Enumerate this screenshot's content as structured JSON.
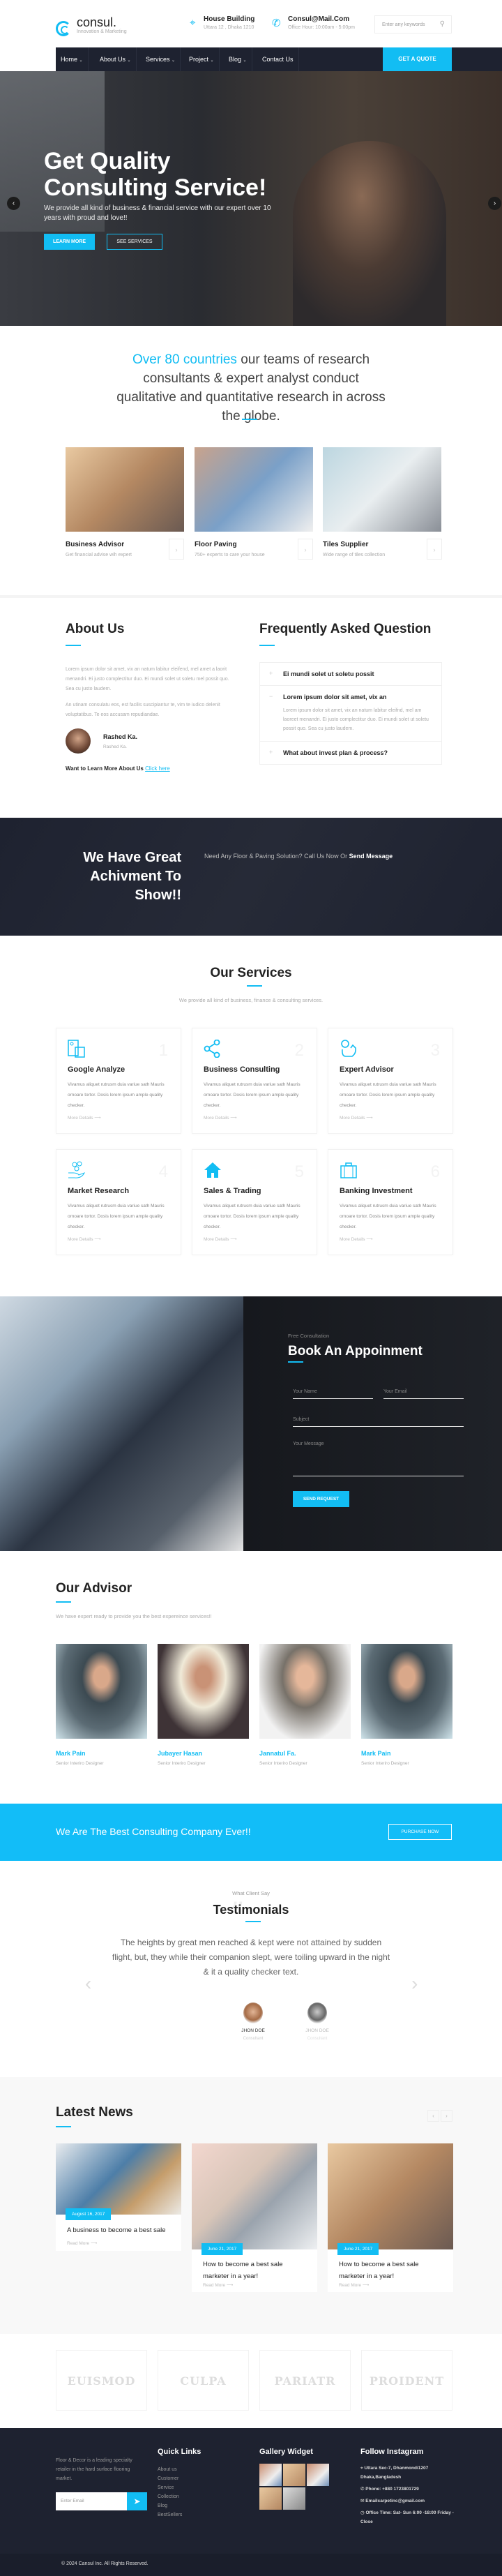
{
  "colors": {
    "accent": "#12bdf3",
    "dark": "#1e2230"
  },
  "header": {
    "logo": {
      "name": "consul.",
      "tagline": "Innovation & Marketing"
    },
    "address": {
      "title": "House Building",
      "sub": "Uttara 12 , Dhaka 1210",
      "icon": "map-pin-icon"
    },
    "contact": {
      "title": "Consul@Mail.Com",
      "sub": "Office Hour: 10:00am - 5:00pm",
      "icon": "phone-icon"
    },
    "search": {
      "placeholder": "Enter any keywords",
      "icon": "search-icon"
    }
  },
  "nav": {
    "items": [
      {
        "label": "Home"
      },
      {
        "label": "About Us"
      },
      {
        "label": "Services"
      },
      {
        "label": "Project"
      },
      {
        "label": "Blog"
      },
      {
        "label": "Contact Us"
      }
    ],
    "cta": "GET A QUOTE"
  },
  "hero": {
    "title": "Get Quality Consulting Service!",
    "desc": "We provide all kind of business & financial service with our expert over 10 years with proud and love!!",
    "learn_more": "LEARN MORE",
    "see_services": "SEE SERVICES"
  },
  "intro": {
    "highlight": "Over 80 countries",
    "text": " our teams of research consultants & expert analyst conduct qualitative and quantitative research in across the globe.",
    "features": [
      {
        "title": "Business Advisor",
        "sub": "Get financial advise wih expert"
      },
      {
        "title": "Floor Paving",
        "sub": "750+ experts to care your house"
      },
      {
        "title": "Tiles Supplier",
        "sub": "Wide range of tiles collection"
      }
    ]
  },
  "about": {
    "title": "About Us",
    "p1": "Lorem ipsum dolor sit amet, vix an natum labitur eleifend, mel amet a laorit menandri. Ei justo complectitur duo. Ei mundi solet ut soletu mel possit quo. Sea cu justo laudem.",
    "p2": "An utinam consulatu eos, est facilis suscipiantur te, vim te iudico delenit voluptatibus. Te eos accusam repudiandae.",
    "person_name": "Rashed Ka.",
    "person_role": "Rashed Ka.",
    "cta_text": "Want to Learn More About Us",
    "cta_link": "Click here"
  },
  "faq": {
    "title": "Frequently Asked Question",
    "items": [
      {
        "q": "Ei mundi solet ut soletu possit",
        "sign": "+"
      },
      {
        "q": "Lorem ipsum dolor sit amet, vix an",
        "sign": "−",
        "a": "Lorem ipsum dolor sit amet, vix an natum labitur eleifnd, mel am laoreet menandri. Ei justo complectitur duo. Ei mundi solet ut soletu possit quo. Sea cu justo laudem."
      },
      {
        "q": "What about invest plan & process?",
        "sign": "+"
      }
    ]
  },
  "achievement": {
    "title": "We Have Great Achivment To Show!!",
    "text": "Need Any Floor & Paving Solution? Call Us Now Or ",
    "link": "Send Message"
  },
  "services": {
    "title": "Our Services",
    "subtitle": "We provide all kind of business, finance & consulting services.",
    "items": [
      {
        "num": "1",
        "title": "Google Analyze",
        "text": "Vivamus aliquet rutrusm duia variue sath Mauris ornoare tortor. Dosis lorem ipsum ample quality checker.",
        "more": "More Details ⟶",
        "icon": "calculator-icon"
      },
      {
        "num": "2",
        "title": "Business Consulting",
        "text": "Vivamus aliquet rutrusm duia variue sath Mauris ornoare tortor. Dosis lorem ipsum ample quality checker.",
        "more": "More Details ⟶",
        "icon": "share-icon"
      },
      {
        "num": "3",
        "title": "Expert Advisor",
        "text": "Vivamus aliquet rutrusm duia variue sath Mauris ornoare tortor. Dosis lorem ipsum ample quality checker.",
        "more": "More Details ⟶",
        "icon": "piggy-bank-icon"
      },
      {
        "num": "4",
        "title": "Market Research",
        "text": "Vivamus aliquet rutrusm duia variue sath Mauris ornoare tortor. Dosis lorem ipsum ample quality checker.",
        "more": "More Details ⟶",
        "icon": "hand-coins-icon"
      },
      {
        "num": "5",
        "title": "Sales & Trading",
        "text": "Vivamus aliquet rutrusm duia variue sath Mauris ornoare tortor. Dosis lorem ipsum ample quality checker.",
        "more": "More Details ⟶",
        "icon": "home-icon"
      },
      {
        "num": "6",
        "title": "Banking Investment",
        "text": "Vivamus aliquet rutrusm duia variue sath Mauris ornoare tortor. Dosis lorem ipsum ample quality checker.",
        "more": "More Details ⟶",
        "icon": "briefcase-icon"
      }
    ]
  },
  "appointment": {
    "kicker": "Free Consultation",
    "title": "Book An Appoinment",
    "name_placeholder": "Your Name",
    "email_placeholder": "Your Email",
    "subject_placeholder": "Subject",
    "message_placeholder": "Your Message",
    "submit": "SEND REQUEST"
  },
  "advisor": {
    "title": "Our Advisor",
    "subtitle": "We have expert ready to provide you the best expereince services!!",
    "people": [
      {
        "name": "Mark Pain",
        "role": "Senior Interiro Designer"
      },
      {
        "name": "Jubayer Hasan",
        "role": "Senior Interiro Designer"
      },
      {
        "name": "Jannatul Fa.",
        "role": "Senior Interiro Designer"
      },
      {
        "name": "Mark Pain",
        "role": "Senior Interiro Designer"
      }
    ]
  },
  "band": {
    "text": "We Are The Best Consulting Company Ever!!",
    "button": "PURCHASE NOW"
  },
  "testimonials": {
    "kicker": "What Client Say",
    "title": "Testimonials",
    "quote": "The heights by great men reached & kept were not attained by sudden flight, but, they while their companion slept, were toiling upward in the night & it a quality checker text.",
    "clients": [
      {
        "name": "JHON DOE",
        "role": "Consultant"
      },
      {
        "name": "JHON DOE",
        "role": "Consultant"
      }
    ]
  },
  "news": {
    "title": "Latest News",
    "posts": [
      {
        "date": "August 16, 2017",
        "title": "A business to become a best sale",
        "more": "Read More ⟶"
      },
      {
        "date": "June 21, 2017",
        "title": "How to become a best sale marketer in a year!",
        "more": "Read More ⟶"
      },
      {
        "date": "June 21, 2017",
        "title": "How to become a best sale marketer in a year!",
        "more": "Read More ⟶"
      }
    ]
  },
  "partners": [
    "EUISMOD",
    "CULPA",
    "PARIATR",
    "PROIDENT"
  ],
  "footer": {
    "about": "Floor & Decor is a leading specialty retailer in the hard surface flooring market.",
    "email_placeholder": "Enter Email",
    "quick_links_title": "Quick Links",
    "quick_links": [
      "About us",
      "Customer",
      "Service",
      "Collection",
      "Blog",
      "BestSellers"
    ],
    "gallery_title": "Gallery Widget",
    "instagram_title": "Follow Instagram",
    "address": "Uttara Sec-7, Dhanmondi1207 Dhaka,Bangladesh",
    "phone": "Phone: +880 1723801729",
    "email": "Emailcarpetinc@gmail.com",
    "hours": "Office Time: Sat- Sun 6:00 -18:00 Friday -Close",
    "copyright": "© 2024 Cansul Inc. All Rights Reserved."
  }
}
